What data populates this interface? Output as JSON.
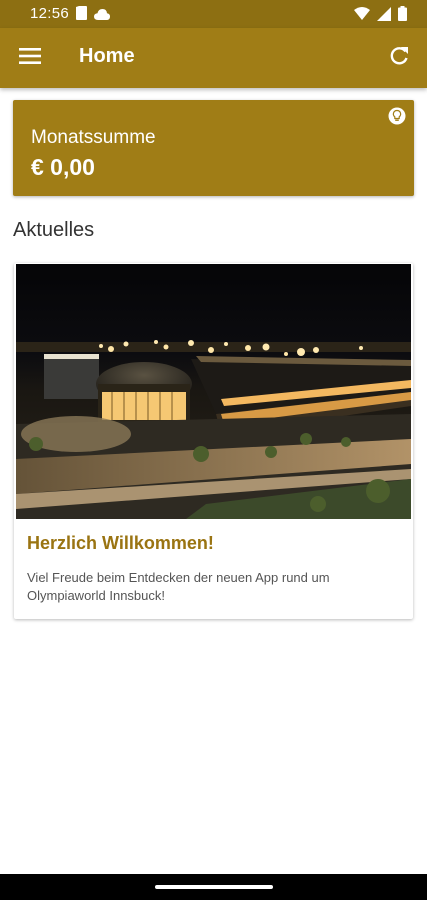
{
  "status_bar": {
    "time": "12:56",
    "left_icons": [
      "sim-card-icon",
      "cloud-icon"
    ],
    "right_icons": [
      "wifi-icon",
      "cell-signal-icon",
      "battery-icon"
    ]
  },
  "app_bar": {
    "title": "Home",
    "menu_icon": "hamburger-menu-icon",
    "refresh_icon": "refresh-icon",
    "color": "#a07d16"
  },
  "sum_card": {
    "label": "Monatssumme",
    "value": "€ 0,00",
    "hint_icon": "lightbulb-icon",
    "color": "#a07d16"
  },
  "section": {
    "title": "Aktuelles"
  },
  "news": [
    {
      "title": "Herzlich Willkommen!",
      "text": "Viel Freude beim Entdecken der neuen App rund um Olympiaworld Innsbuck!",
      "title_color": "#9a7412"
    }
  ]
}
